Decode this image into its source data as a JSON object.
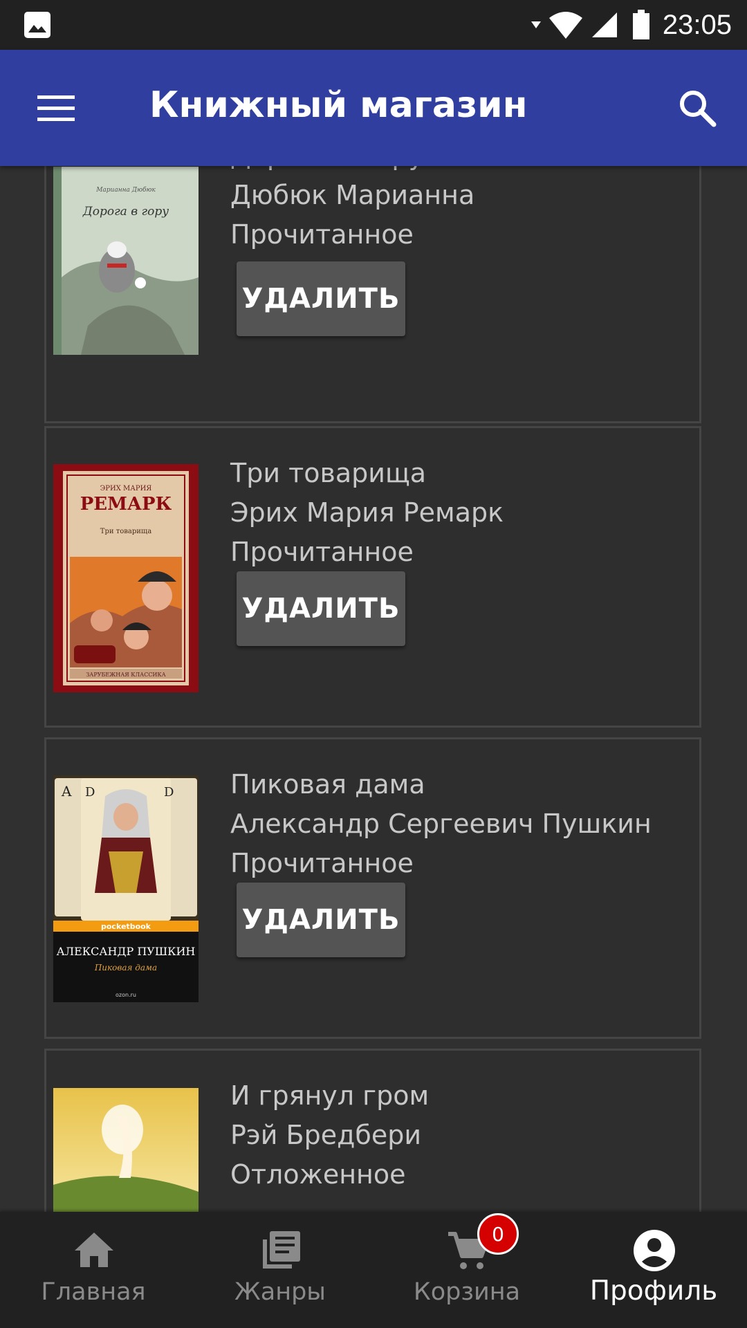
{
  "status_bar": {
    "time": "23:05"
  },
  "app_bar": {
    "title": "Книжный магазин"
  },
  "books": [
    {
      "title": "Дорога в гору",
      "author": "Дюбюк Марианна",
      "status": "Прочитанное",
      "delete_label": "УДАЛИТЬ",
      "cover_text": "Дорога в гору",
      "cover_author": "Марианна Дюбюк"
    },
    {
      "title": "Три товарища",
      "author": "Эрих Мария Ремарк",
      "status": "Прочитанное",
      "delete_label": "УДАЛИТЬ",
      "cover_author_top": "ЭРИХ МАРИЯ",
      "cover_author": "РЕМАРК",
      "cover_text": "Три товарища",
      "cover_series": "ЗАРУБЕЖНАЯ КЛАССИКА"
    },
    {
      "title": "Пиковая дама",
      "author": "Александр Сергеевич Пушкин",
      "status": "Прочитанное",
      "delete_label": "УДАЛИТЬ",
      "cover_brand": "pocketbook",
      "cover_author": "АЛЕКСАНДР ПУШКИН",
      "cover_text": "Пиковая дама",
      "cover_publisher": "ozon.ru"
    },
    {
      "title": "И грянул гром",
      "author": "Рэй Бредбери",
      "status": "Отложенное"
    }
  ],
  "bottom_nav": {
    "items": [
      {
        "label": "Главная",
        "icon": "home-icon"
      },
      {
        "label": "Жанры",
        "icon": "library-books-icon"
      },
      {
        "label": "Корзина",
        "icon": "cart-icon",
        "badge": "0"
      },
      {
        "label": "Профиль",
        "icon": "account-circle-icon",
        "active": true
      }
    ]
  },
  "colors": {
    "app_bar": "#303f9f",
    "background": "#303030",
    "card": "#2e2e2e",
    "button": "#545454",
    "badge": "#d50000",
    "nav_bar": "#212121"
  }
}
